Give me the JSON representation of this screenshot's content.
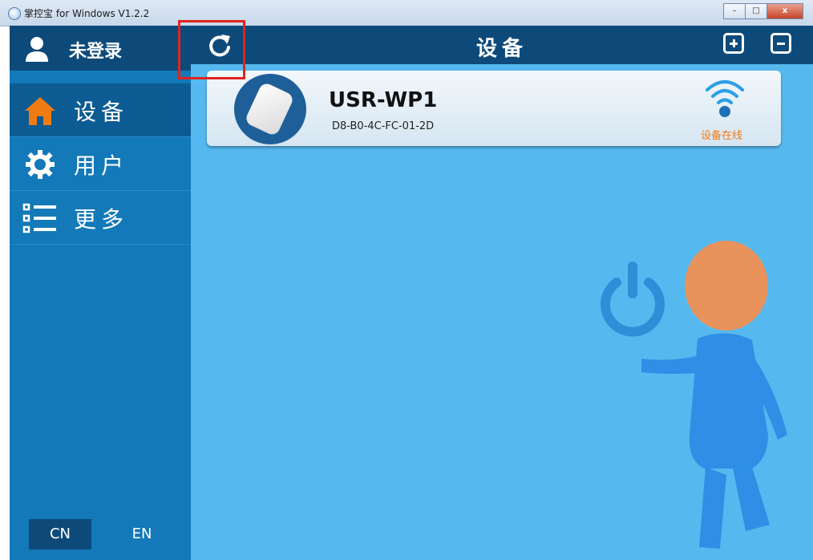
{
  "window": {
    "title": "掌控宝 for Windows V1.2.2",
    "minimize": "–",
    "maximize": "□",
    "close": "x"
  },
  "sidebar": {
    "user_label": "未登录",
    "items": [
      {
        "label": "设备",
        "icon": "home-icon",
        "active": true
      },
      {
        "label": "用户",
        "icon": "gear-icon",
        "active": false
      },
      {
        "label": "更多",
        "icon": "list-icon",
        "active": false
      }
    ],
    "languages": {
      "cn": "CN",
      "en": "EN"
    }
  },
  "header": {
    "title": "设备",
    "refresh_icon": "refresh-icon",
    "add_icon": "plus-icon",
    "remove_icon": "minus-icon"
  },
  "devices": [
    {
      "name": "USR-WP1",
      "mac": "D8-B0-4C-FC-01-2D",
      "status": "设备在线",
      "status_color": "#f07b13"
    }
  ],
  "colors": {
    "header": "#0d4a7a",
    "sidebar": "#1379b8",
    "main_bg": "#55b9ef",
    "active_icon": "#f07b13",
    "highlight": "#e0241f"
  }
}
